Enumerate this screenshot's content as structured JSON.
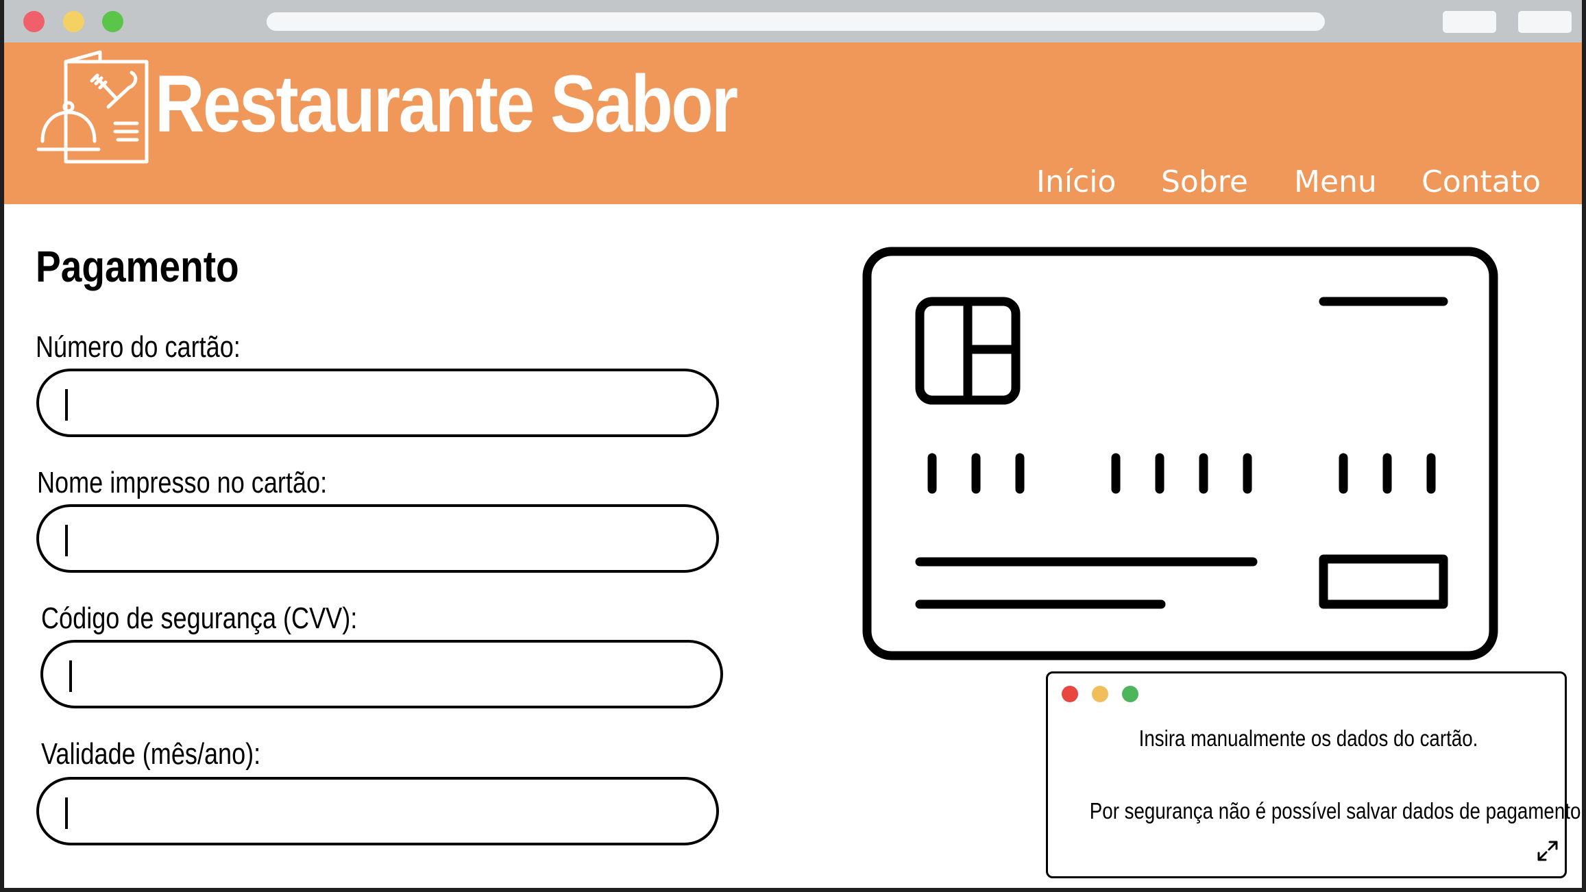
{
  "window": {
    "controls": [
      "close",
      "minimize",
      "maximize"
    ]
  },
  "header": {
    "brand": "Restaurante Sabor",
    "logo_icon": "restaurant-menu-cloche-icon",
    "nav": [
      "Início",
      "Sobre",
      "Menu",
      "Contato"
    ],
    "background_color": "#f0975a"
  },
  "form": {
    "title": "Pagamento",
    "fields": [
      {
        "label": "Número do cartão:",
        "value": ""
      },
      {
        "label": "Nome impresso no cartão:",
        "value": ""
      },
      {
        "label": "Código de segurança (CVV):",
        "value": ""
      },
      {
        "label": "Validade (mês/ano):",
        "value": ""
      }
    ]
  },
  "illustration": {
    "icon": "credit-card-icon"
  },
  "popup": {
    "line1": "Insira manualmente os dados do cartão.",
    "line2": "Por segurança não é possível salvar dados de pagamento.",
    "expand_icon": "expand-icon"
  }
}
